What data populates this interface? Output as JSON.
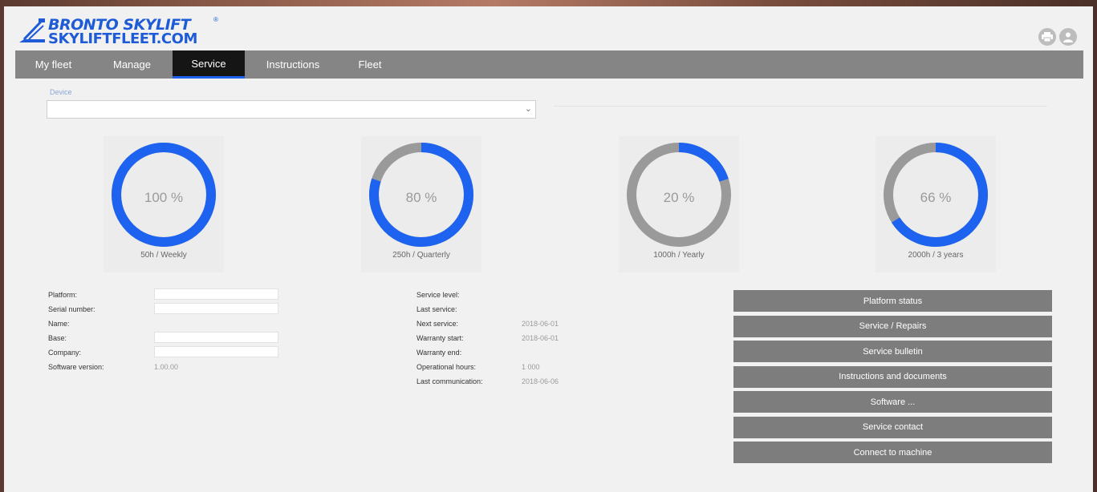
{
  "brand": {
    "line1": "BRONTO SKYLIFT",
    "line2": "SKYLIFTFLEET.COM",
    "reg": "®",
    "color": "#1e5bd6"
  },
  "header_icons": [
    "print-icon",
    "user-icon"
  ],
  "nav": {
    "tabs": [
      {
        "label": "My fleet"
      },
      {
        "label": "Manage"
      },
      {
        "label": "Service",
        "active": true
      },
      {
        "label": "Instructions"
      },
      {
        "label": "Fleet"
      }
    ],
    "active_color": "#1e63f0"
  },
  "device": {
    "label": "Device",
    "value": ""
  },
  "gauges": [
    {
      "percent_text": "100 %",
      "caption": "50h / Weekly",
      "fraction": 1.0
    },
    {
      "percent_text": "80 %",
      "caption": "250h / Quarterly",
      "fraction": 0.8
    },
    {
      "percent_text": "20 %",
      "caption": "1000h / Yearly",
      "fraction": 0.2
    },
    {
      "percent_text": "66 %",
      "caption": "2000h / 3 years",
      "fraction": 0.66
    }
  ],
  "gauge_colors": {
    "fill": "#1e63f0",
    "track": "#9a9a9a"
  },
  "platform_info": {
    "platform_label": "Platform:",
    "serial_label": "Serial number:",
    "name_label": "Name:",
    "base_label": "Base:",
    "company_label": "Company:",
    "software_label": "Software version:",
    "software_value": "1.00.00"
  },
  "service_info": {
    "service_level_label": "Service level:",
    "last_service_label": "Last service:",
    "next_service_label": "Next service:",
    "next_service_value": "2018-06-01",
    "warranty_start_label": "Warranty start:",
    "warranty_start_value": "2018-06-01",
    "warranty_end_label": "Warranty end:",
    "operational_hours_label": "Operational hours:",
    "operational_hours_value": "1 000",
    "last_communication_label": "Last communication:",
    "last_communication_value": "2018-06-06"
  },
  "actions": [
    "Platform status",
    "Service / Repairs",
    "Service bulletin",
    "Instructions and documents",
    "Software ...",
    "Service contact",
    "Connect to machine"
  ]
}
